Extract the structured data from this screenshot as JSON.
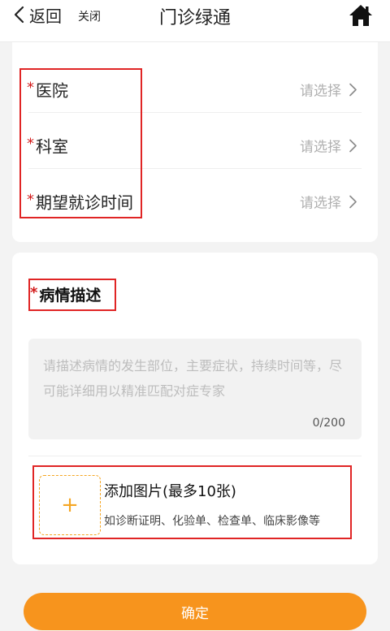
{
  "header": {
    "back_label": "返回",
    "close_label": "关闭",
    "title": "门诊绿通",
    "home_icon": "home-icon"
  },
  "form": {
    "required_mark": "*",
    "rows": [
      {
        "label": "医院",
        "placeholder": "请选择"
      },
      {
        "label": "科室",
        "placeholder": "请选择"
      },
      {
        "label": "期望就诊时间",
        "placeholder": "请选择"
      }
    ]
  },
  "description": {
    "title": "病情描述",
    "placeholder": "请描述病情的发生部位，主要症状，持续时间等，尽可能详细用以精准匹配对症专家",
    "value": "",
    "counter": "0/200"
  },
  "upload": {
    "plus": "+",
    "title": "添加图片(最多10张)",
    "subtitle": "如诊断证明、化验单、检查单、临床影像等"
  },
  "footer": {
    "confirm_label": "确定"
  },
  "colors": {
    "accent": "#f7941d",
    "required": "#d21a1a",
    "highlight_box": "#e02525"
  }
}
